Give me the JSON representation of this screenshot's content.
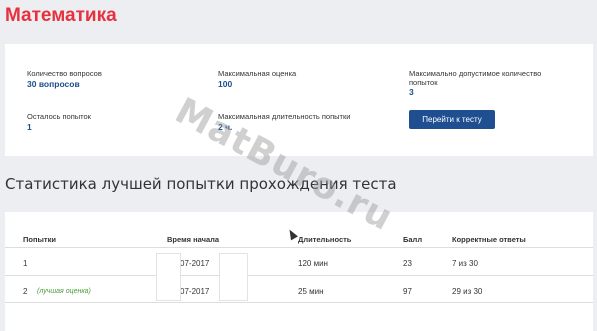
{
  "page": {
    "title": "Математика"
  },
  "info": {
    "questions_label": "Количество вопросов",
    "questions_value": "30 вопросов",
    "max_score_label": "Максимальная оценка",
    "max_score_value": "100",
    "max_attempts_label": "Максимально допустимое количество попыток",
    "max_attempts_value": "3",
    "remaining_label": "Осталось попыток",
    "remaining_value": "1",
    "max_duration_label": "Максимальная длительность попытки",
    "max_duration_value": "2 ч.",
    "go_button": "Перейти к тесту"
  },
  "stats": {
    "title": "Статистика лучшей попытки прохождения теста",
    "headers": [
      "Попытки",
      "Время начала",
      "Длительность",
      "Балл",
      "Корректные ответы"
    ],
    "rows": [
      {
        "attempt": "1",
        "note": "",
        "start": "07-2017",
        "duration": "120 мин",
        "score": "23",
        "correct": "7 из 30"
      },
      {
        "attempt": "2",
        "note": "(лучшая оценка)",
        "start": "07-2017",
        "duration": "25 мин",
        "score": "97",
        "correct": "29 из 30"
      }
    ]
  },
  "watermark": "MatBuro.ru"
}
